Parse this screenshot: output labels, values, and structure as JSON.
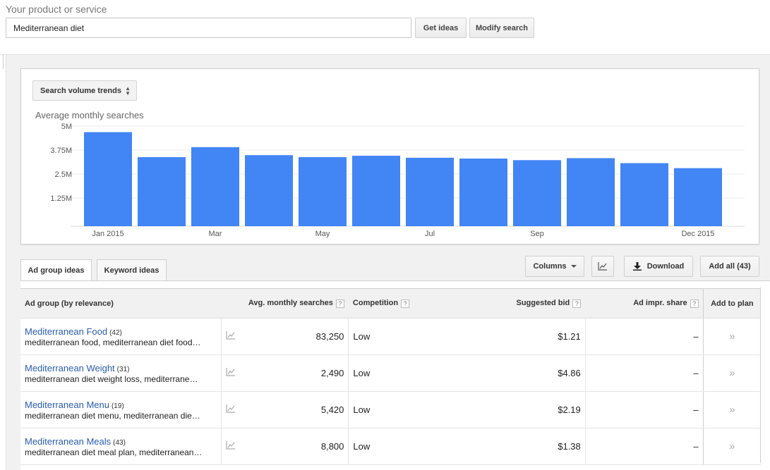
{
  "search": {
    "label": "Your product or service",
    "value": "Mediterranean diet",
    "get_ideas": "Get ideas",
    "modify_search": "Modify search"
  },
  "chart_panel": {
    "dropdown": "Search volume trends",
    "title": "Average monthly searches"
  },
  "chart_data": {
    "type": "bar",
    "title": "Average monthly searches",
    "categories": [
      "Jan 2015",
      "Feb 2015",
      "Mar 2015",
      "Apr 2015",
      "May 2015",
      "Jun 2015",
      "Jul 2015",
      "Aug 2015",
      "Sep 2015",
      "Oct 2015",
      "Nov 2015",
      "Dec 2015"
    ],
    "x_tick_labels": [
      "Jan 2015",
      "Mar",
      "May",
      "Jul",
      "Sep",
      "Dec 2015"
    ],
    "values": [
      4700000,
      3450000,
      3950000,
      3550000,
      3450000,
      3520000,
      3420000,
      3380000,
      3300000,
      3400000,
      3150000,
      2900000
    ],
    "y_ticks": [
      "5M",
      "3.75M",
      "2.5M",
      "1.25M"
    ],
    "ylim": [
      0,
      5000000
    ],
    "grid": true,
    "color": "#4285f4"
  },
  "tabs": {
    "ad_group": "Ad group ideas",
    "keyword": "Keyword ideas"
  },
  "toolbar": {
    "columns": "Columns",
    "chart_icon": "line-chart-icon",
    "download": "Download",
    "add_all": "Add all (43)"
  },
  "table": {
    "headers": {
      "group": "Ad group (by relevance)",
      "searches": "Avg. monthly searches",
      "competition": "Competition",
      "bid": "Suggested bid",
      "share": "Ad impr. share",
      "add": "Add to plan"
    },
    "help": "?",
    "rows": [
      {
        "name": "Mediterranean Food",
        "count": "(42)",
        "keywords": "mediterranean food, mediterranean diet food…",
        "searches": "83,250",
        "competition": "Low",
        "bid": "$1.21",
        "share": "–",
        "add": "»"
      },
      {
        "name": "Mediterranean Weight",
        "count": "(31)",
        "keywords": "mediterranean diet weight loss, mediterrane…",
        "searches": "2,490",
        "competition": "Low",
        "bid": "$4.86",
        "share": "–",
        "add": "»"
      },
      {
        "name": "Mediterranean Menu",
        "count": "(19)",
        "keywords": "mediterranean diet menu, mediterranean die…",
        "searches": "5,420",
        "competition": "Low",
        "bid": "$2.19",
        "share": "–",
        "add": "»"
      },
      {
        "name": "Mediterranean Meals",
        "count": "(43)",
        "keywords": "mediterranean diet meal plan, mediterranean…",
        "searches": "8,800",
        "competition": "Low",
        "bid": "$1.38",
        "share": "–",
        "add": "»"
      }
    ]
  }
}
